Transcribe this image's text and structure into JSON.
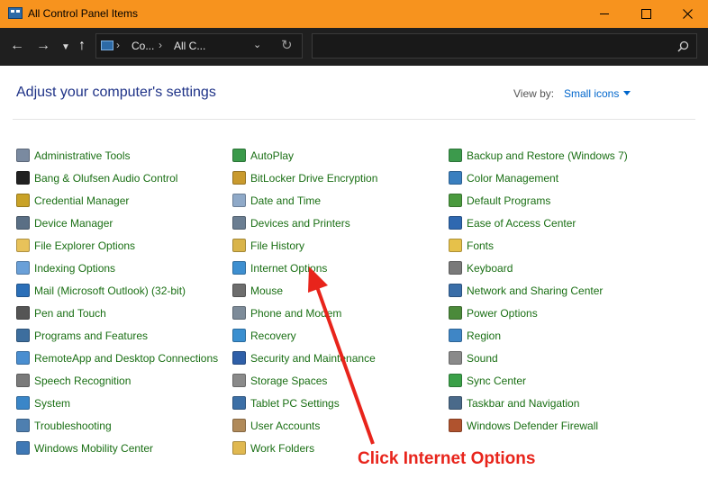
{
  "window": {
    "title": "All Control Panel Items",
    "accent_color": "#f7931e"
  },
  "address_bar": {
    "breadcrumbs": [
      "Co...",
      "All C..."
    ],
    "search_placeholder": ""
  },
  "content": {
    "heading": "Adjust your computer's settings",
    "view_by_label": "View by:",
    "view_by_value": "Small icons",
    "link_color": "#1a6f14"
  },
  "columns": [
    [
      {
        "label": "Administrative Tools",
        "icon": "admin-tools-icon",
        "color": "#7a8aa0"
      },
      {
        "label": "Bang & Olufsen Audio Control",
        "icon": "audio-control-icon",
        "color": "#222222"
      },
      {
        "label": "Credential Manager",
        "icon": "credential-icon",
        "color": "#c9a227"
      },
      {
        "label": "Device Manager",
        "icon": "device-manager-icon",
        "color": "#5a6f85"
      },
      {
        "label": "File Explorer Options",
        "icon": "folder-options-icon",
        "color": "#e8c25a"
      },
      {
        "label": "Indexing Options",
        "icon": "indexing-icon",
        "color": "#6aa0d8"
      },
      {
        "label": "Mail (Microsoft Outlook) (32-bit)",
        "icon": "mail-icon",
        "color": "#2b6fb8"
      },
      {
        "label": "Pen and Touch",
        "icon": "pen-icon",
        "color": "#555555"
      },
      {
        "label": "Programs and Features",
        "icon": "programs-icon",
        "color": "#3d6e9e"
      },
      {
        "label": "RemoteApp and Desktop Connections",
        "icon": "remote-desktop-icon",
        "color": "#4a8ed0"
      },
      {
        "label": "Speech Recognition",
        "icon": "microphone-icon",
        "color": "#7a7a7a"
      },
      {
        "label": "System",
        "icon": "system-icon",
        "color": "#3a86c8"
      },
      {
        "label": "Troubleshooting",
        "icon": "troubleshooting-icon",
        "color": "#4e7fb0"
      },
      {
        "label": "Windows Mobility Center",
        "icon": "mobility-icon",
        "color": "#3f78b5"
      }
    ],
    [
      {
        "label": "AutoPlay",
        "icon": "autoplay-icon",
        "color": "#3a9a4a"
      },
      {
        "label": "BitLocker Drive Encryption",
        "icon": "bitlocker-icon",
        "color": "#c99a2e"
      },
      {
        "label": "Date and Time",
        "icon": "date-time-icon",
        "color": "#8fa9c8"
      },
      {
        "label": "Devices and Printers",
        "icon": "printer-icon",
        "color": "#6b7e92"
      },
      {
        "label": "File History",
        "icon": "file-history-icon",
        "color": "#d9b44a"
      },
      {
        "label": "Internet Options",
        "icon": "globe-icon",
        "color": "#3e8fd0"
      },
      {
        "label": "Mouse",
        "icon": "mouse-icon",
        "color": "#6d6d6d"
      },
      {
        "label": "Phone and Modem",
        "icon": "phone-icon",
        "color": "#7d8b99"
      },
      {
        "label": "Recovery",
        "icon": "recovery-icon",
        "color": "#3a8fd0"
      },
      {
        "label": "Security and Maintenance",
        "icon": "flag-icon",
        "color": "#2f5fa8"
      },
      {
        "label": "Storage Spaces",
        "icon": "storage-icon",
        "color": "#8a8a8a"
      },
      {
        "label": "Tablet PC Settings",
        "icon": "tablet-icon",
        "color": "#3c6fa6"
      },
      {
        "label": "User Accounts",
        "icon": "users-icon",
        "color": "#b08a5a"
      },
      {
        "label": "Work Folders",
        "icon": "work-folders-icon",
        "color": "#e0b850"
      }
    ],
    [
      {
        "label": "Backup and Restore (Windows 7)",
        "icon": "backup-icon",
        "color": "#3c9a4c"
      },
      {
        "label": "Color Management",
        "icon": "color-management-icon",
        "color": "#3a7fbf"
      },
      {
        "label": "Default Programs",
        "icon": "default-programs-icon",
        "color": "#4a9a3e"
      },
      {
        "label": "Ease of Access Center",
        "icon": "ease-of-access-icon",
        "color": "#2f68b0"
      },
      {
        "label": "Fonts",
        "icon": "fonts-icon",
        "color": "#e6c14a"
      },
      {
        "label": "Keyboard",
        "icon": "keyboard-icon",
        "color": "#7a7a7a"
      },
      {
        "label": "Network and Sharing Center",
        "icon": "network-icon",
        "color": "#3a6ea8"
      },
      {
        "label": "Power Options",
        "icon": "power-icon",
        "color": "#4b8a3a"
      },
      {
        "label": "Region",
        "icon": "region-icon",
        "color": "#3f86c6"
      },
      {
        "label": "Sound",
        "icon": "speaker-icon",
        "color": "#8a8a8a"
      },
      {
        "label": "Sync Center",
        "icon": "sync-icon",
        "color": "#3aa048"
      },
      {
        "label": "Taskbar and Navigation",
        "icon": "taskbar-icon",
        "color": "#4a6a8a"
      },
      {
        "label": "Windows Defender Firewall",
        "icon": "firewall-icon",
        "color": "#b0532e"
      }
    ]
  ],
  "annotation": {
    "text": "Click Internet Options",
    "color": "#e8241b"
  }
}
